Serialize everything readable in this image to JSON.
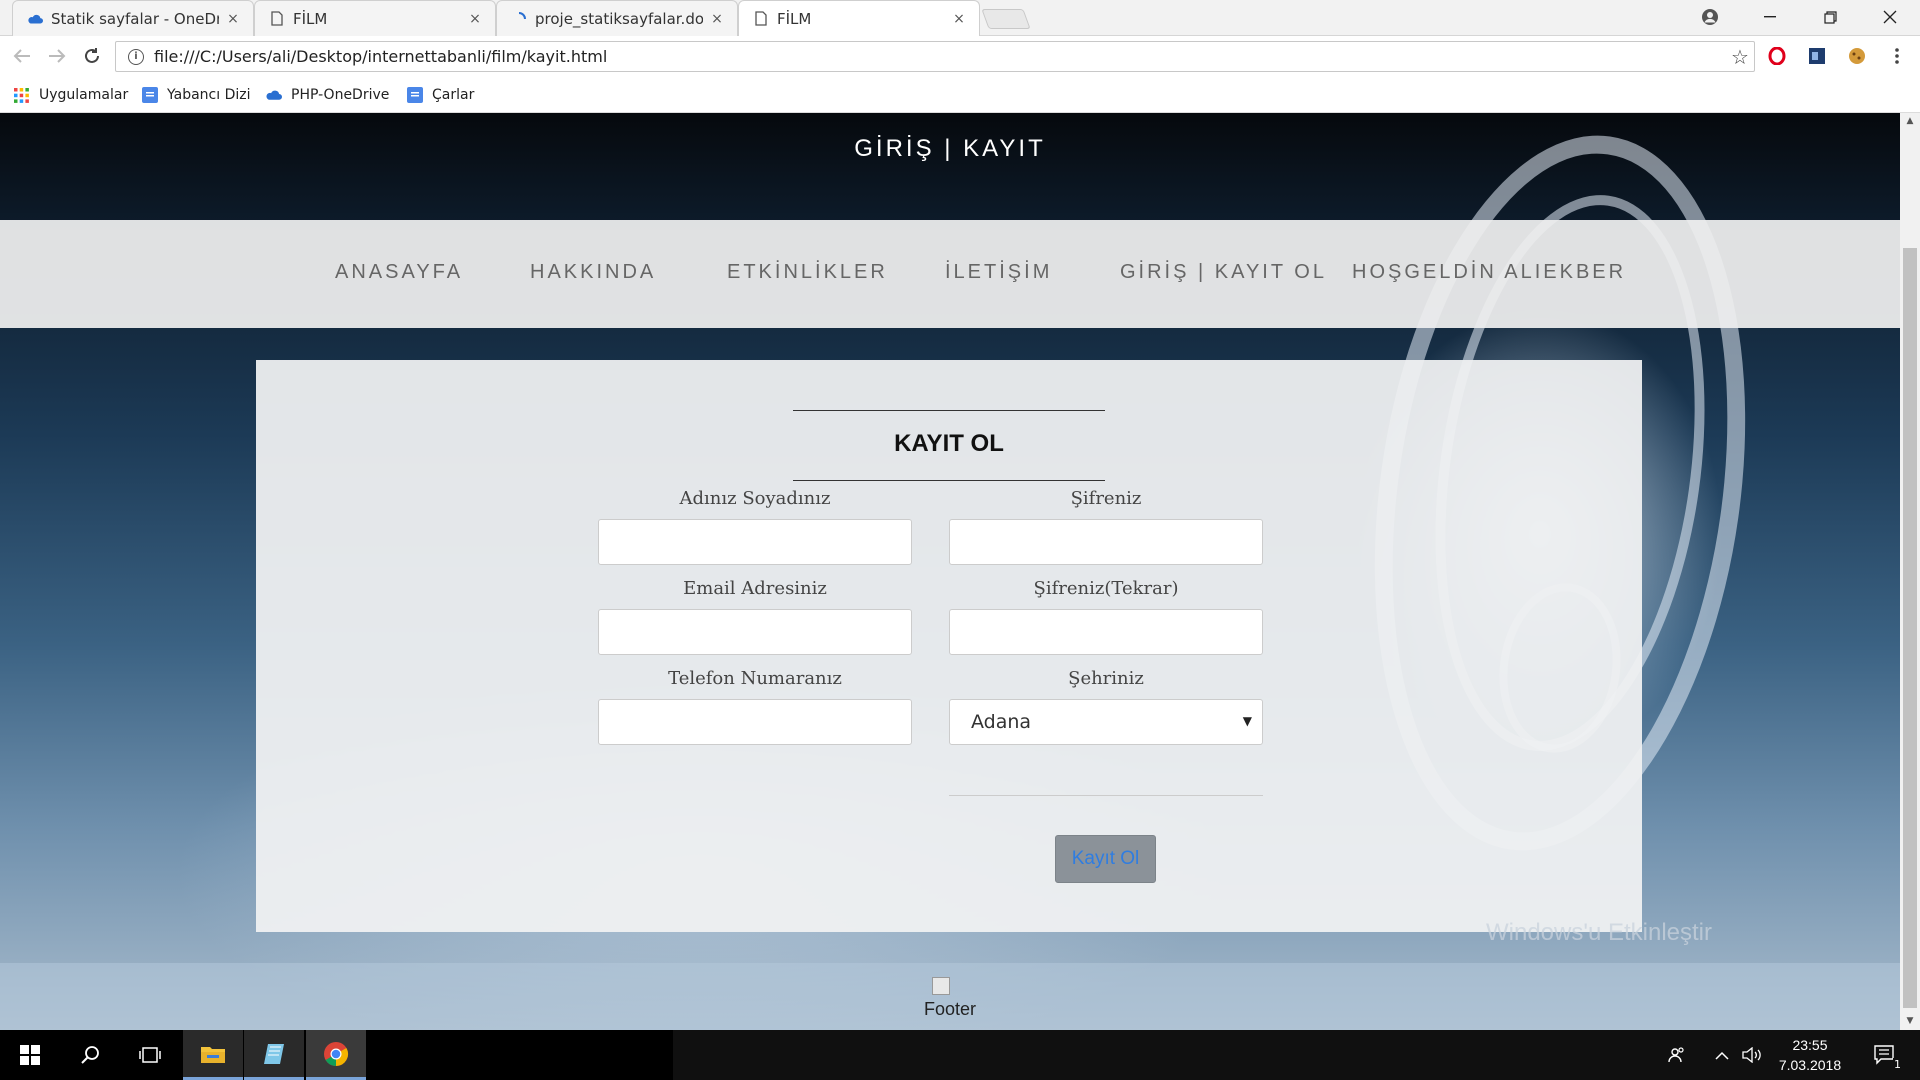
{
  "browser": {
    "tabs": [
      {
        "label": "Statik sayfalar - OneDrive",
        "icon": "onedrive-icon",
        "active": false
      },
      {
        "label": "FİLM",
        "icon": "page-icon",
        "active": false
      },
      {
        "label": "proje_statiksayfalar.docx",
        "icon": "loading-icon",
        "active": false
      },
      {
        "label": "FİLM",
        "icon": "page-icon",
        "active": true
      }
    ],
    "close_glyph": "×",
    "url": "file:///C:/Users/ali/Desktop/internettabanli/film/kayit.html",
    "bookmarks": [
      {
        "label": "Uygulamalar",
        "icon": "apps-grid-icon"
      },
      {
        "label": "Yabancı Dizi",
        "icon": "doc-icon"
      },
      {
        "label": "PHP-OneDrive",
        "icon": "onedrive-icon"
      },
      {
        "label": "Çarlar",
        "icon": "doc-icon"
      }
    ]
  },
  "site": {
    "title": "GİRİŞ | KAYIT",
    "nav": [
      "ANASAYFA",
      "HAKKINDA",
      "ETKİNLİKLER",
      "İLETİŞİM",
      "GİRİŞ | KAYIT OL",
      "HOŞGELDİN ALIEKBER"
    ]
  },
  "form": {
    "title": "KAYIT OL",
    "fields": {
      "name_label": "Adınız Soyadınız",
      "password_label": "Şifreniz",
      "email_label": "Email Adresiniz",
      "password2_label": "Şifreniz(Tekrar)",
      "phone_label": "Telefon Numaranız",
      "city_label": "Şehriniz",
      "city_value": "Adana"
    },
    "submit_label": "Kayıt Ol"
  },
  "watermark": {
    "title": "Windows'u Etkinleştir"
  },
  "footer": {
    "alt_text": "Footer"
  },
  "taskbar": {
    "time": "23:55",
    "date": "7.03.2018",
    "notifications": "1"
  },
  "colors": {
    "submit_text": "#2f7de1",
    "submit_bg": "#8b9299",
    "taskbar": "#101010"
  }
}
